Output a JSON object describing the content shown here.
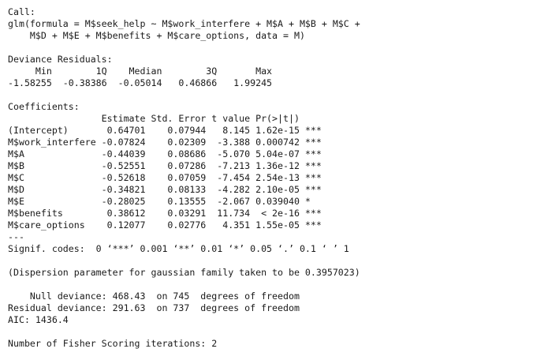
{
  "console": {
    "lines": [
      "Call:",
      "glm(formula = M$seek_help ~ M$work_interfere + M$A + M$B + M$C +",
      "    M$D + M$E + M$benefits + M$care_options, data = M)",
      "",
      "Deviance Residuals:",
      "     Min        1Q    Median        3Q       Max",
      "-1.58255  -0.38386  -0.05014   0.46866   1.99245",
      "",
      "Coefficients:",
      "                 Estimate Std. Error t value Pr(>|t|)",
      "(Intercept)       0.64701    0.07944   8.145 1.62e-15 ***",
      "M$work_interfere -0.07824    0.02309  -3.388 0.000742 ***",
      "M$A              -0.44039    0.08686  -5.070 5.04e-07 ***",
      "M$B              -0.52551    0.07286  -7.213 1.36e-12 ***",
      "M$C              -0.52618    0.07059  -7.454 2.54e-13 ***",
      "M$D              -0.34821    0.08133  -4.282 2.10e-05 ***",
      "M$E              -0.28025    0.13555  -2.067 0.039040 *",
      "M$benefits        0.38612    0.03291  11.734  < 2e-16 ***",
      "M$care_options    0.12077    0.02776   4.351 1.55e-05 ***",
      "---",
      "Signif. codes:  0 ‘***’ 0.001 ‘**’ 0.01 ‘*’ 0.05 ‘.’ 0.1 ‘ ’ 1",
      "",
      "(Dispersion parameter for gaussian family taken to be 0.3957023)",
      "",
      "    Null deviance: 468.43  on 745  degrees of freedom",
      "Residual deviance: 291.63  on 737  degrees of freedom",
      "AIC: 1436.4",
      "",
      "Number of Fisher Scoring iterations: 2"
    ]
  }
}
